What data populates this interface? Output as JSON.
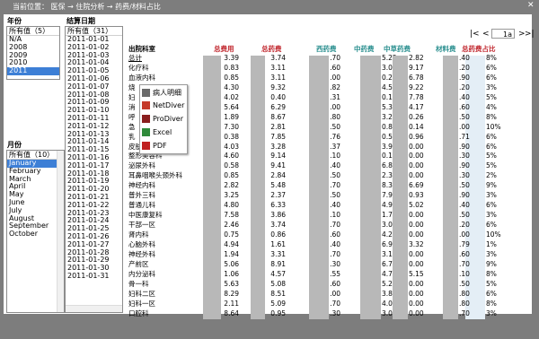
{
  "header": {
    "breadcrumb": "当前位置： 医保 → 住院分析 → 药费/材料占比",
    "close_glyph": "✕"
  },
  "filters": {
    "year": {
      "label": "年份",
      "header": "所有值（5）",
      "items": [
        "N/A",
        "2008",
        "2009",
        "2010",
        "2011"
      ],
      "selected": "2011"
    },
    "date": {
      "label": "结算日期",
      "header": "所有值（31）",
      "items": [
        "2011-01-01",
        "2011-01-02",
        "2011-01-03",
        "2011-01-04",
        "2011-01-05",
        "2011-01-06",
        "2011-01-07",
        "2011-01-08",
        "2011-01-09",
        "2011-01-10",
        "2011-01-11",
        "2011-01-12",
        "2011-01-13",
        "2011-01-14",
        "2011-01-15",
        "2011-01-16",
        "2011-01-17",
        "2011-01-18",
        "2011-01-19",
        "2011-01-20",
        "2011-01-21",
        "2011-01-22",
        "2011-01-23",
        "2011-01-24",
        "2011-01-25",
        "2011-01-26",
        "2011-01-27",
        "2011-01-28",
        "2011-01-29",
        "2011-01-30",
        "2011-01-31"
      ]
    },
    "month": {
      "label": "月份",
      "header": "所有值（10）",
      "items": [
        "January",
        "February",
        "March",
        "April",
        "May",
        "June",
        "July",
        "August",
        "September",
        "October"
      ],
      "selected": "January"
    }
  },
  "pager": {
    "first": "|<",
    "prev": "<",
    "page_value": "1a",
    "next": ">",
    "last": ">|"
  },
  "table": {
    "headers": [
      "出院科室",
      "总费用",
      "总药费",
      "西药费",
      "中药费",
      "中草药费",
      "材料费",
      "总药费占比"
    ],
    "rows": [
      [
        "总计",
        "3.39",
        "3.74",
        ".70",
        "5.22",
        "2.82",
        ".40",
        "8%"
      ],
      [
        "化疗科",
        "0.83",
        "3.11",
        ".60",
        "3.07",
        "9.17",
        ".20",
        "6%"
      ],
      [
        "血液内科",
        "0.85",
        "3.11",
        ".00",
        "0.22",
        "6.78",
        ".90",
        "6%"
      ],
      [
        "烧",
        "4.30",
        "9.32",
        ".82",
        "4.54",
        "9.22",
        ".20",
        "3%"
      ],
      [
        "妇",
        "4.02",
        "0.40",
        ".31",
        "0.17",
        "7.78",
        ".40",
        "5%"
      ],
      [
        "消",
        "5.64",
        "6.29",
        ".00",
        "5.32",
        "4.17",
        ".60",
        "4%"
      ],
      [
        "呼",
        "1.89",
        "8.67",
        ".80",
        "3.22",
        "0.26",
        ".50",
        "8%"
      ],
      [
        "急",
        "7.30",
        "2.81",
        ".50",
        "0.89",
        "0.14",
        ".00",
        "10%"
      ],
      [
        "乳",
        "0.38",
        "7.85",
        ".76",
        "0.51",
        "0.96",
        ".71",
        "6%"
      ],
      [
        "皮肤科",
        "4.03",
        "3.28",
        ".37",
        "3.91",
        "0.00",
        ".90",
        "6%"
      ],
      [
        "整形美容科",
        "4.60",
        "9.14",
        ".10",
        "0.14",
        "0.00",
        ".30",
        "5%"
      ],
      [
        "泌尿外科",
        "0.58",
        "9.41",
        ".40",
        "6.85",
        "0.00",
        ".90",
        "5%"
      ],
      [
        "耳鼻咽喉头颈外科",
        "0.85",
        "2.84",
        ".50",
        "2.34",
        "0.00",
        ".30",
        "2%"
      ],
      [
        "神经内科",
        "2.82",
        "5.48",
        ".70",
        "8.39",
        "6.69",
        ".50",
        "9%"
      ],
      [
        "普外三科",
        "3.25",
        "2.37",
        ".50",
        "7.95",
        "0.93",
        ".90",
        "3%"
      ],
      [
        "普通儿科",
        "4.80",
        "6.33",
        ".40",
        "4.93",
        "5.02",
        ".40",
        "6%"
      ],
      [
        "中医康复科",
        "7.58",
        "3.86",
        ".10",
        "1.76",
        "0.00",
        ".50",
        "3%"
      ],
      [
        "干部一区",
        "2.46",
        "3.74",
        ".70",
        "3.04",
        "0.00",
        ".20",
        "6%"
      ],
      [
        "肾内科",
        "0.75",
        "0.86",
        ".60",
        "4.26",
        "0.00",
        ".00",
        "10%"
      ],
      [
        "心脑外科",
        "4.94",
        "1.61",
        ".40",
        "6.93",
        "3.32",
        ".79",
        "1%"
      ],
      [
        "神经外科",
        "1.94",
        "3.31",
        ".70",
        "3.15",
        "0.00",
        ".60",
        "3%"
      ],
      [
        "产前区",
        "5.06",
        "8.91",
        ".30",
        "6.74",
        "0.00",
        ".70",
        "9%"
      ],
      [
        "内分泌科",
        "1.06",
        "4.57",
        ".55",
        "4.77",
        "5.15",
        ".10",
        "8%"
      ],
      [
        "骨一科",
        "5.63",
        "5.08",
        ".60",
        "5.21",
        "0.00",
        ".50",
        "5%"
      ],
      [
        "妇科二区",
        "8.29",
        "8.51",
        ".00",
        "3.84",
        "0.00",
        ".80",
        "6%"
      ],
      [
        "妇科一区",
        "2.11",
        "5.09",
        ".70",
        "4.06",
        "0.00",
        ".80",
        "8%"
      ],
      [
        "口腔科",
        "8.64",
        "0.95",
        ".30",
        "3.04",
        "0.00",
        ".70",
        "3%"
      ]
    ]
  },
  "export_menu": {
    "items": [
      {
        "label": "病人明细",
        "icon": "patient-detail-icon",
        "color": "#6a6a6a"
      },
      {
        "label": "NetDiver",
        "icon": "netdiver-icon",
        "color": "#c53a2a"
      },
      {
        "label": "ProDiver",
        "icon": "prodiver-icon",
        "color": "#8a1e1e"
      },
      {
        "label": "Excel",
        "icon": "excel-icon",
        "color": "#2f8a3a"
      },
      {
        "label": "PDF",
        "icon": "pdf-icon",
        "color": "#c02020"
      }
    ]
  },
  "colors": {
    "background": "#7d7d7d",
    "selection": "#3d7fd6",
    "header_red": "#c0262d",
    "header_teal": "#2a8f8f",
    "percent_band": "#e4eef6"
  }
}
